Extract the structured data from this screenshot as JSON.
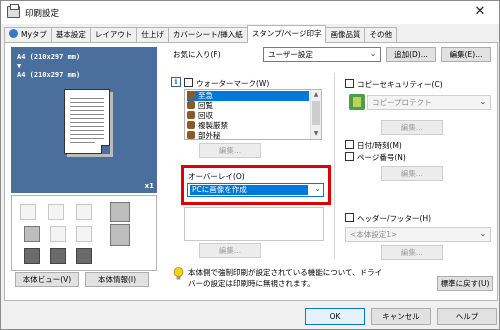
{
  "window": {
    "title": "印刷設定",
    "close_glyph": "✕"
  },
  "tabs": [
    {
      "label": "Myタブ",
      "icon": "my-tab-icon"
    },
    {
      "label": "基本設定"
    },
    {
      "label": "レイアウト"
    },
    {
      "label": "仕上げ"
    },
    {
      "label": "カバーシート/挿入紙"
    },
    {
      "label": "スタンプ/ページ印字",
      "active": true
    },
    {
      "label": "画像品質"
    },
    {
      "label": "その他"
    }
  ],
  "preview": {
    "line1": "A4 (210x297 mm)",
    "arrow": "▼",
    "line2": "A4 (210x297 mm)",
    "copies": "x1",
    "background_color": "#4a6f9c"
  },
  "left_buttons": {
    "view": "本体ビュー(V)",
    "info": "本体情報(I)"
  },
  "favorites": {
    "label": "お気に入り(F)",
    "value": "ユーザー設定",
    "add_button": "追加(D)...",
    "edit_button": "編集(E)..."
  },
  "watermark": {
    "checkbox_label": "ウォーターマーク(W)",
    "items": [
      "至急",
      "回覧",
      "回収",
      "複製厳禁",
      "部外秘"
    ],
    "selected_index": 0,
    "edit_button": "編集..."
  },
  "overlay": {
    "label": "オーバーレイ(O)",
    "value": "PCに画像を作成",
    "edit_button": "編集..."
  },
  "copy_security": {
    "checkbox_label": "コピーセキュリティー(C)",
    "value": "コピープロテクト",
    "edit_button": "編集..."
  },
  "date_time": {
    "checkbox_label": "日付/時刻(M)"
  },
  "page_number": {
    "checkbox_label": "ページ番号(N)",
    "edit_button": "編集..."
  },
  "header_footer": {
    "checkbox_label": "ヘッダー/フッター(H)",
    "value": "<本体設定1>",
    "edit_button": "編集..."
  },
  "notice": {
    "line1": "本体側で強制印刷が設定されている機能について、ドライ",
    "line2": "バーの設定は印刷時に無視されます。",
    "reset_button": "標準に戻す(U)"
  },
  "footer_buttons": {
    "ok": "OK",
    "cancel": "キャンセル",
    "help": "ヘルプ"
  },
  "colors": {
    "highlight": "#0078d7",
    "red_frame": "#e00000"
  }
}
